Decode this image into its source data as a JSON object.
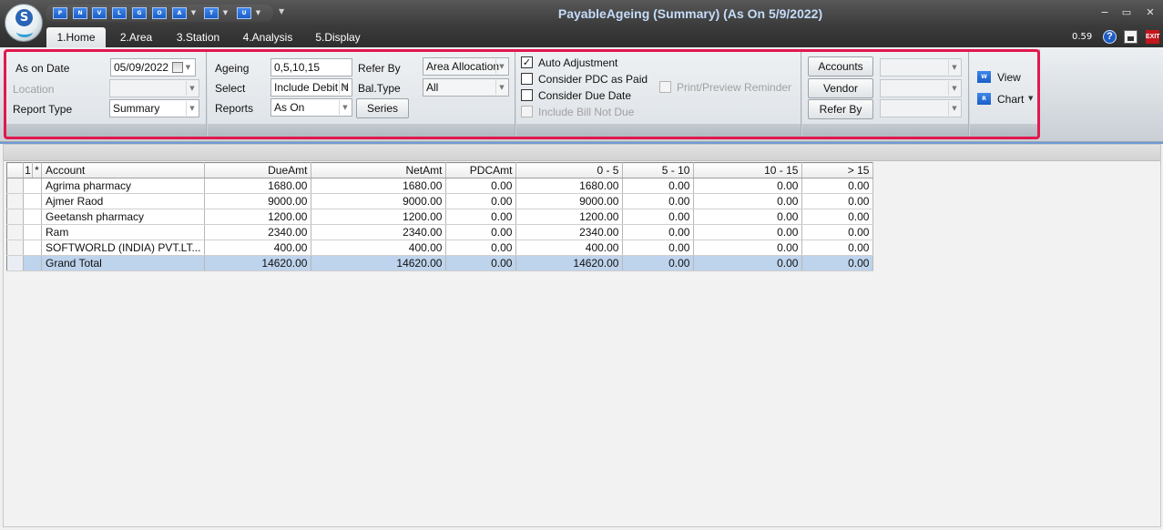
{
  "window": {
    "title": "PayableAgeing (Summary) (As On 5/9/2022)",
    "minimize": "−",
    "restore": "▭",
    "close": "✕"
  },
  "quick_access": [
    {
      "letter": "P",
      "icon": "print-icon"
    },
    {
      "letter": "N",
      "icon": "new-icon"
    },
    {
      "letter": "V",
      "icon": "view-icon"
    },
    {
      "letter": "L",
      "icon": "list-icon"
    },
    {
      "letter": "G",
      "icon": "graph-icon"
    },
    {
      "letter": "O",
      "icon": "open-icon"
    },
    {
      "letter": "A",
      "icon": "action-icon"
    },
    {
      "letter": "T",
      "icon": "tools-icon"
    },
    {
      "letter": "U",
      "icon": "user-icon"
    }
  ],
  "tabs": [
    "1.Home",
    "2.Area",
    "3.Station",
    "4.Analysis",
    "5.Display"
  ],
  "active_tab": "1.Home",
  "version": "0.59",
  "colors": {
    "highlight": "#e3174f",
    "selected_row": "#bed3ec",
    "title_text": "#c5dcfa"
  },
  "ribbon": {
    "date_group": {
      "as_on_date_label": "As on Date",
      "as_on_date_value": "05/09/2022",
      "location_label": "Location",
      "location_value": "",
      "report_type_label": "Report Type",
      "report_type_value": "Summary"
    },
    "ageing_group": {
      "ageing_label": "Ageing",
      "ageing_value": "0,5,10,15",
      "select_label": "Select",
      "select_value": "Include Debit N",
      "reports_label": "Reports",
      "reports_value": "As On",
      "refer_by_label": "Refer By",
      "refer_by_value": "Area Allocation",
      "bal_type_label": "Bal.Type",
      "bal_type_value": "All",
      "series_button": "Series"
    },
    "options_group": {
      "auto_adjustment": {
        "label": "Auto Adjustment",
        "checked": true
      },
      "consider_pdc": {
        "label": "Consider PDC as Paid",
        "checked": false
      },
      "consider_due_date": {
        "label": "Consider Due Date",
        "checked": false
      },
      "include_bill_not_due": {
        "label": "Include Bill Not Due",
        "checked": false
      },
      "print_preview_reminder": {
        "label": "Print/Preview Reminder",
        "checked": false
      }
    },
    "filter_group": {
      "accounts_button": "Accounts",
      "vendor_button": "Vendor",
      "refer_by_button": "Refer By"
    },
    "view_group": {
      "view_label": "View",
      "view_icon_letter": "W",
      "chart_label": "Chart",
      "chart_icon_letter": "R"
    }
  },
  "grid": {
    "header_row_num": "1",
    "header_star": "*",
    "columns": [
      "Account",
      "DueAmt",
      "NetAmt",
      "PDCAmt",
      "0 - 5",
      "5 - 10",
      "10 - 15",
      "> 15"
    ],
    "rows": [
      [
        "Agrima pharmacy",
        "1680.00",
        "1680.00",
        "0.00",
        "1680.00",
        "0.00",
        "0.00",
        "0.00"
      ],
      [
        "Ajmer Raod",
        "9000.00",
        "9000.00",
        "0.00",
        "9000.00",
        "0.00",
        "0.00",
        "0.00"
      ],
      [
        "Geetansh pharmacy",
        "1200.00",
        "1200.00",
        "0.00",
        "1200.00",
        "0.00",
        "0.00",
        "0.00"
      ],
      [
        "Ram",
        "2340.00",
        "2340.00",
        "0.00",
        "2340.00",
        "0.00",
        "0.00",
        "0.00"
      ],
      [
        "SOFTWORLD (INDIA) PVT.LT...",
        "400.00",
        "400.00",
        "0.00",
        "400.00",
        "0.00",
        "0.00",
        "0.00"
      ]
    ],
    "total_row": [
      "Grand Total",
      "14620.00",
      "14620.00",
      "0.00",
      "14620.00",
      "0.00",
      "0.00",
      "0.00"
    ]
  }
}
